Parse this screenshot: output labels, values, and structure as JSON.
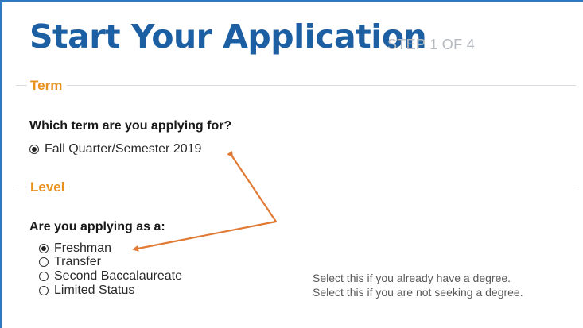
{
  "header": {
    "title": "Start Your Application",
    "step": "STEP 1 OF 4"
  },
  "term_section": {
    "legend": "Term",
    "question": "Which term are you applying for?",
    "options": [
      {
        "label": "Fall Quarter/Semester 2019",
        "checked": true
      }
    ]
  },
  "level_section": {
    "legend": "Level",
    "question": "Are you applying as a:",
    "options": [
      {
        "label": "Freshman",
        "checked": true,
        "hint": ""
      },
      {
        "label": "Transfer",
        "checked": false,
        "hint": ""
      },
      {
        "label": "Second Baccalaureate",
        "checked": false,
        "hint": "Select this if you already have a degree."
      },
      {
        "label": "Limited Status",
        "checked": false,
        "hint": "Select this if you are not seeking a degree."
      }
    ]
  },
  "colors": {
    "title": "#1d5fa3",
    "legend": "#e8911f",
    "frame": "#2f78c2",
    "annotation_arrow": "#e07a34"
  }
}
